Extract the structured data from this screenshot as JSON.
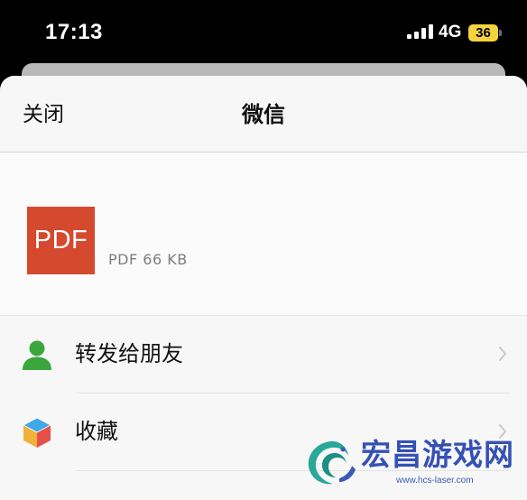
{
  "status_bar": {
    "time": "17:13",
    "network": "4G",
    "battery_level": "36",
    "battery_color": "#f5d33f"
  },
  "sheet": {
    "close_label": "关闭",
    "title": "微信"
  },
  "file": {
    "thumbnail_label": "PDF",
    "thumbnail_color": "#d5492f",
    "meta": "PDF 66 KB"
  },
  "actions": [
    {
      "label": "转发给朋友",
      "icon": "person-icon",
      "icon_color": "#3aa63c"
    },
    {
      "label": "收藏",
      "icon": "cube-icon"
    }
  ],
  "watermark": {
    "name": "宏昌游戏网",
    "url": "www.hcs-laser.com",
    "color": "#3551b5"
  }
}
